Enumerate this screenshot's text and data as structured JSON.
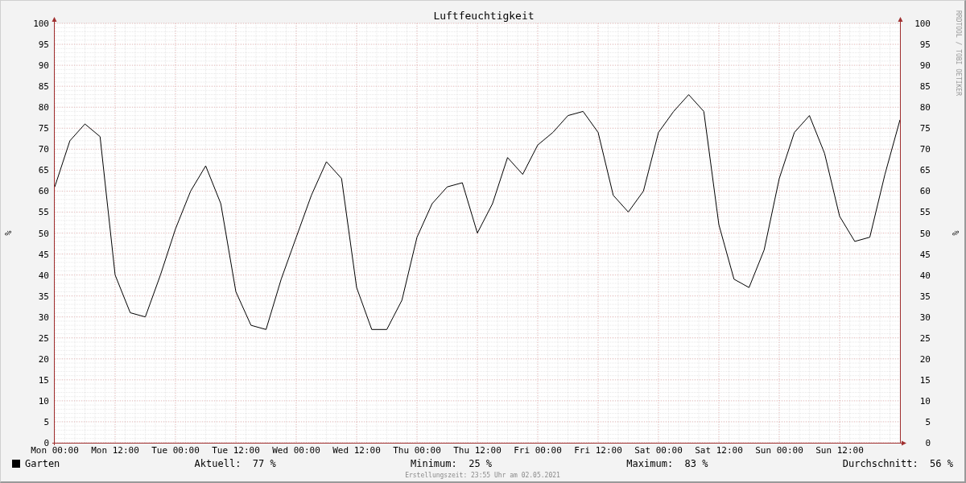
{
  "chart": {
    "chart_data": {
      "type": "line",
      "title": "Luftfeuchtigkeit",
      "ylabel": "%",
      "categories": [
        "Mon 00:00",
        null,
        null,
        null,
        "Mon 12:00",
        null,
        null,
        null,
        "Tue 00:00",
        null,
        null,
        null,
        "Tue 12:00",
        null,
        null,
        null,
        "Wed 00:00",
        null,
        null,
        null,
        "Wed 12:00",
        null,
        null,
        null,
        "Thu 00:00",
        null,
        null,
        null,
        "Thu 12:00",
        null,
        null,
        null,
        "Fri 00:00",
        null,
        null,
        null,
        "Fri 12:00",
        null,
        null,
        null,
        "Sat 00:00",
        null,
        null,
        null,
        "Sat 12:00",
        null,
        null,
        null,
        "Sun 00:00",
        null,
        null,
        null,
        "Sun 12:00",
        null,
        null,
        null,
        null
      ],
      "series": [
        {
          "name": "Garten",
          "color": "#000000",
          "values": [
            61,
            72,
            76,
            73,
            40,
            31,
            30,
            40,
            51,
            60,
            66,
            57,
            36,
            28,
            27,
            39,
            49,
            59,
            67,
            63,
            37,
            27,
            27,
            34,
            49,
            57,
            61,
            62,
            50,
            57,
            68,
            64,
            71,
            74,
            78,
            79,
            74,
            59,
            55,
            60,
            74,
            79,
            83,
            79,
            52,
            39,
            37,
            46,
            63,
            74,
            78,
            69,
            54,
            48,
            49,
            64,
            77
          ]
        }
      ],
      "ylim": [
        0,
        100
      ],
      "grid": true,
      "yticks": [
        0,
        5,
        10,
        15,
        20,
        25,
        30,
        35,
        40,
        45,
        50,
        55,
        60,
        65,
        70,
        75,
        80,
        85,
        90,
        95,
        100
      ]
    },
    "right_axis": {
      "label": "%",
      "ticks": [
        "100",
        "95",
        "90",
        "85",
        "80",
        "75",
        "70",
        "65",
        "60",
        "55",
        "50",
        "45",
        "40",
        "35",
        "30",
        "25",
        "20",
        "15",
        "10",
        "5",
        "0"
      ]
    },
    "credit": "RRDTOOL / TOBI OETIKER"
  },
  "legend": {
    "stats": [
      {
        "label": "Aktuell:",
        "value": "77 %"
      },
      {
        "label": "Minimum:",
        "value": "25 %"
      },
      {
        "label": "Maximum:",
        "value": "83 %"
      },
      {
        "label": "Durchschnitt:",
        "value": "56 %"
      }
    ]
  },
  "footer": "Erstellungszeit: 23:55 Uhr am 02.05.2021"
}
